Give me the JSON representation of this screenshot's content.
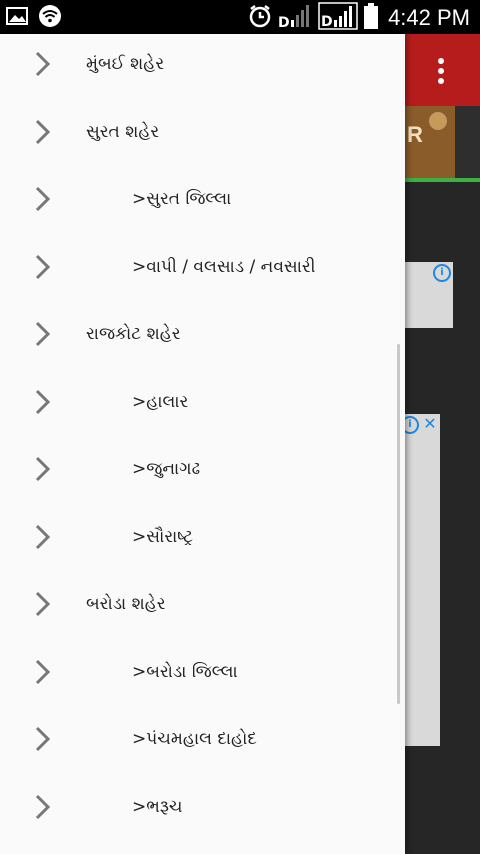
{
  "status_bar": {
    "time": "4:42 PM",
    "icons": [
      "gallery-icon",
      "wifi-icon",
      "alarm-icon",
      "signal-icon",
      "signal-icon",
      "battery-icon"
    ]
  },
  "drawer": {
    "items": [
      {
        "label": "મુંબઈ શહેર",
        "indent": 0
      },
      {
        "label": "સુરત શહેર",
        "indent": 0
      },
      {
        "label": ">સુરત જિલ્લા",
        "indent": 1
      },
      {
        "label": ">વાપી / વલસાડ / નવસારી",
        "indent": 1
      },
      {
        "label": "રાજકોટ શહેર",
        "indent": 0
      },
      {
        "label": ">હાલાર",
        "indent": 1
      },
      {
        "label": ">જુનાગઢ",
        "indent": 1
      },
      {
        "label": ">સૌરાષ્ટ્ર",
        "indent": 1
      },
      {
        "label": "બરોડા શહેર",
        "indent": 0
      },
      {
        "label": ">બરોડા જિલ્લા",
        "indent": 1
      },
      {
        "label": ">પંચમહાલ દાહોદ",
        "indent": 1
      },
      {
        "label": ">ભરૂચ",
        "indent": 1
      }
    ]
  },
  "background": {
    "appbar_color": "#b71c1c",
    "overflow_icon": "more-vert-icon",
    "banner_text": "R"
  }
}
